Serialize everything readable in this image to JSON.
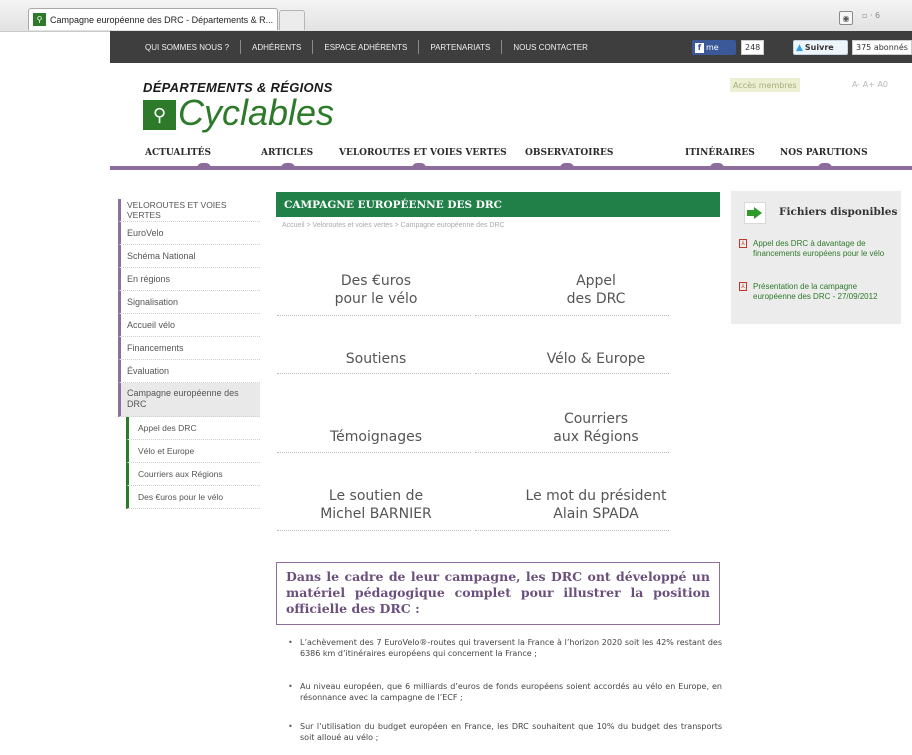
{
  "browser": {
    "tab_title": "Campagne européenne des DRC - Départements & R...",
    "favicon": "site-favicon",
    "rss": "rss-icon",
    "extra": "▫ · 6"
  },
  "topnav": {
    "links": [
      "QUI SOMMES NOUS ?",
      "ADHÉRENTS",
      "ESPACE ADHÉRENTS",
      "PARTENARIATS",
      "NOUS CONTACTER"
    ],
    "facebook_label": "me",
    "facebook_count": "248",
    "twitter_label": "Suivre",
    "twitter_count": "375 abonnés"
  },
  "header": {
    "logo_line1": "DÉPARTEMENTS & RÉGIONS",
    "logo_line2": "Cyclables",
    "members_label": "Accès membres",
    "font_controls": "A- A+ A0"
  },
  "mainnav": {
    "items": [
      "ACTUALITÉS",
      "ARTICLES",
      "VELOROUTES ET VOIES VERTES",
      "OBSERVATOIRES",
      "ITINÉRAIRES",
      "NOS PARUTIONS"
    ]
  },
  "sidebar": {
    "header": "VELOROUTES ET VOIES VERTES",
    "items": [
      "EuroVelo",
      "Schéma National",
      "En régions",
      "Signalisation",
      "Accueil vélo",
      "Financements",
      "Évaluation"
    ],
    "active": "Campagne européenne des DRC",
    "subitems": [
      "Appel des DRC",
      "Vélo et Europe",
      "Courriers aux Régions",
      "Des €uros pour le vélo"
    ]
  },
  "content": {
    "title": "CAMPAGNE EUROPÉENNE DES DRC",
    "breadcrumb": "Accueil > Veloroutes et voies vertes > Campagne européenne des DRC",
    "tiles": [
      [
        "Des €uros",
        "pour le vélo"
      ],
      [
        "Appel",
        "des DRC"
      ],
      [
        "Soutiens",
        ""
      ],
      [
        "Vélo & Europe",
        ""
      ],
      [
        "Témoignages",
        ""
      ],
      [
        "Courriers",
        "aux Régions"
      ],
      [
        "Le soutien de",
        "Michel BARNIER"
      ],
      [
        "Le mot du président",
        "Alain SPADA"
      ]
    ],
    "intro": "Dans le cadre de leur campagne, les DRC ont développé un matériel pédagogique complet pour illustrer la position officielle des DRC :",
    "bullets": [
      "L’achèvement des 7 EuroVelo®-routes qui traversent la France à l’horizon 2020 soit les 42% restant des 6386 km d’itinéraires européens qui concernent la France ;",
      "Au niveau européen, que 6 milliards d’euros de fonds européens soient accordés au vélo en Europe, en résonnance avec la campagne de l’ECF ;",
      "Sur l’utilisation du budget européen en France, les DRC souhaitent que 10% du budget des transports soit alloué au vélo ;"
    ]
  },
  "files": {
    "title": "Fichiers disponibles",
    "links": [
      "Appel des DRC à davantage de financements européens pour le vélo",
      "Présentation de la campagne européenne des DRC - 27/09/2012"
    ]
  }
}
